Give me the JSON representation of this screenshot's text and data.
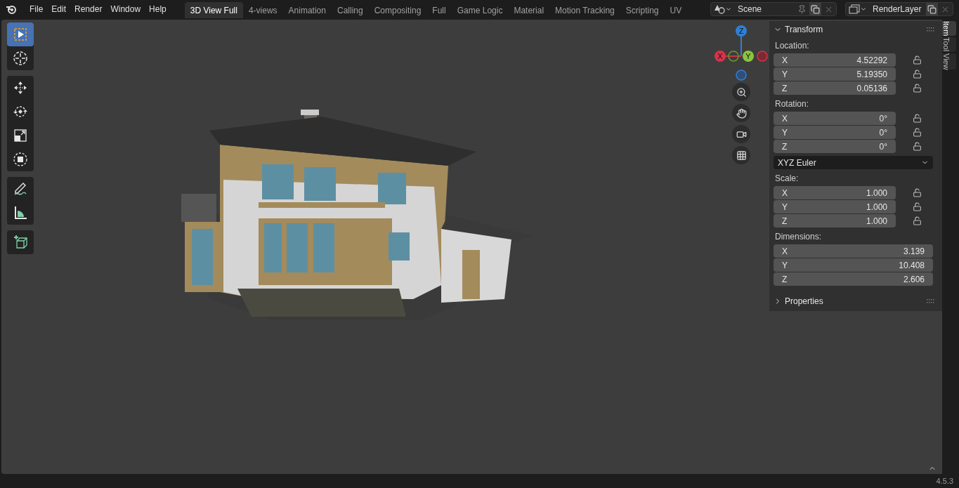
{
  "menu": [
    "File",
    "Edit",
    "Render",
    "Window",
    "Help"
  ],
  "workspaces": [
    {
      "label": "3D View Full",
      "selected": true
    },
    {
      "label": "4-views",
      "selected": false
    },
    {
      "label": "Animation",
      "selected": false
    },
    {
      "label": "Calling",
      "selected": false
    },
    {
      "label": "Compositing",
      "selected": false
    },
    {
      "label": "Full",
      "selected": false
    },
    {
      "label": "Game Logic",
      "selected": false
    },
    {
      "label": "Material",
      "selected": false
    },
    {
      "label": "Motion Tracking",
      "selected": false
    },
    {
      "label": "Scripting",
      "selected": false
    },
    {
      "label": "UV",
      "selected": false
    }
  ],
  "scene": "Scene",
  "view_layer": "RenderLayer",
  "tool_groups": [
    [
      {
        "kind": "select",
        "selected": true
      },
      {
        "kind": "cursor",
        "selected": false
      }
    ],
    [
      {
        "kind": "move",
        "selected": false
      },
      {
        "kind": "rotate",
        "selected": false
      },
      {
        "kind": "scale",
        "selected": false
      },
      {
        "kind": "transform",
        "selected": false
      }
    ],
    [
      {
        "kind": "annotate",
        "selected": false
      },
      {
        "kind": "measure",
        "selected": false
      }
    ],
    [
      {
        "kind": "add-cube",
        "selected": false
      }
    ]
  ],
  "gizmo": {
    "x": "X",
    "y": "Y",
    "z": "Z"
  },
  "transform": {
    "title": "Transform",
    "expanded": true,
    "groups": [
      {
        "label": "Location:",
        "fields": [
          {
            "axis": "X",
            "value": "4.52292",
            "locked": false
          },
          {
            "axis": "Y",
            "value": "5.19350",
            "locked": false
          },
          {
            "axis": "Z",
            "value": "0.05136",
            "locked": false
          }
        ]
      },
      {
        "label": "Rotation:",
        "fields": [
          {
            "axis": "X",
            "value": "0°",
            "locked": false
          },
          {
            "axis": "Y",
            "value": "0°",
            "locked": false
          },
          {
            "axis": "Z",
            "value": "0°",
            "locked": false
          }
        ],
        "mode": "XYZ Euler"
      },
      {
        "label": "Scale:",
        "fields": [
          {
            "axis": "X",
            "value": "1.000",
            "locked": false
          },
          {
            "axis": "Y",
            "value": "1.000",
            "locked": false
          },
          {
            "axis": "Z",
            "value": "1.000",
            "locked": false
          }
        ]
      },
      {
        "label": "Dimensions:",
        "fields": [
          {
            "axis": "X",
            "value": "3.139"
          },
          {
            "axis": "Y",
            "value": "10.408"
          },
          {
            "axis": "Z",
            "value": "2.606"
          }
        ]
      }
    ]
  },
  "properties": {
    "title": "Properties",
    "expanded": false
  },
  "sidebar_tabs": [
    {
      "label": "Item",
      "selected": true
    },
    {
      "label": "Tool",
      "selected": false
    },
    {
      "label": "View",
      "selected": false
    }
  ],
  "status_bar": {
    "version": "4.5.3"
  }
}
